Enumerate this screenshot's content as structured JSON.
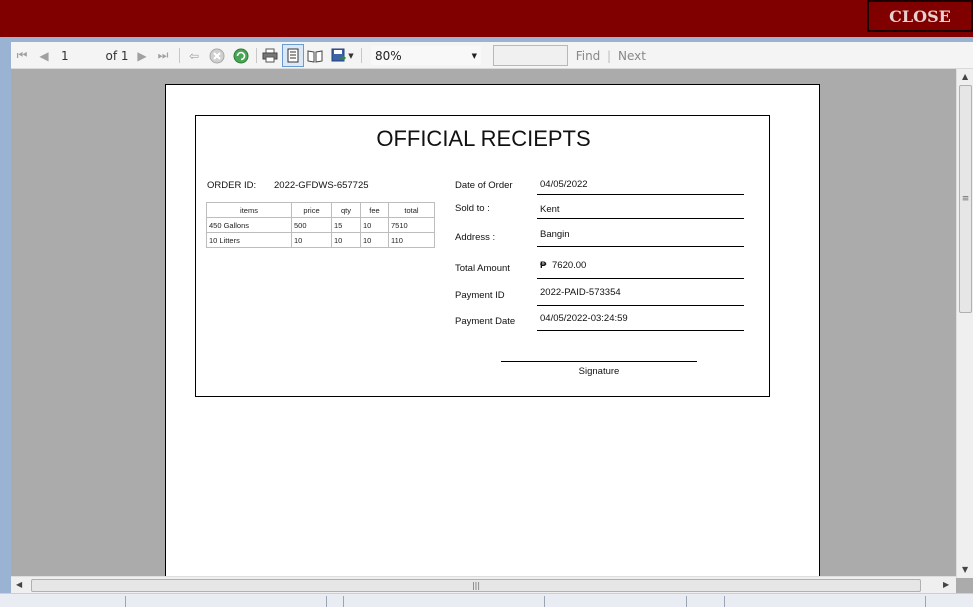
{
  "header": {
    "close_label": "CLOSE",
    "accent_color": "#800000"
  },
  "toolbar": {
    "page_current": "1",
    "page_of": "of 1",
    "zoom": "80%",
    "find_label": "Find",
    "find_divider": "|",
    "next_label": "Next"
  },
  "receipt": {
    "title": "OFFICIAL RECIEPTS",
    "order_id_label": "ORDER ID:",
    "order_id": "2022-GFDWS-657725",
    "table": {
      "headers": [
        "items",
        "price",
        "qty",
        "fee",
        "total"
      ],
      "rows": [
        [
          "450 Gallons",
          "500",
          "15",
          "10",
          "7510"
        ],
        [
          "10 Litters",
          "10",
          "10",
          "10",
          "110"
        ]
      ]
    },
    "fields": {
      "date_of_order_label": "Date of Order",
      "date_of_order": "04/05/2022",
      "sold_to_label": "Sold to :",
      "sold_to": "Kent",
      "address_label": "Address :",
      "address": "Bangin",
      "total_amount_label": "Total Amount",
      "currency_symbol": "₱",
      "total_amount": "7620.00",
      "payment_id_label": "Payment ID",
      "payment_id": "2022-PAID-573354",
      "payment_date_label": "Payment Date",
      "payment_date": "04/05/2022-03:24:59"
    },
    "signature_label": "Signature"
  },
  "icons": [
    "first-page-icon",
    "prev-page-icon",
    "next-page-icon",
    "last-page-icon",
    "back-icon",
    "stop-icon",
    "refresh-icon",
    "print-icon",
    "print-layout-icon",
    "page-setup-icon",
    "export-icon",
    "dropdown-caret-icon"
  ]
}
